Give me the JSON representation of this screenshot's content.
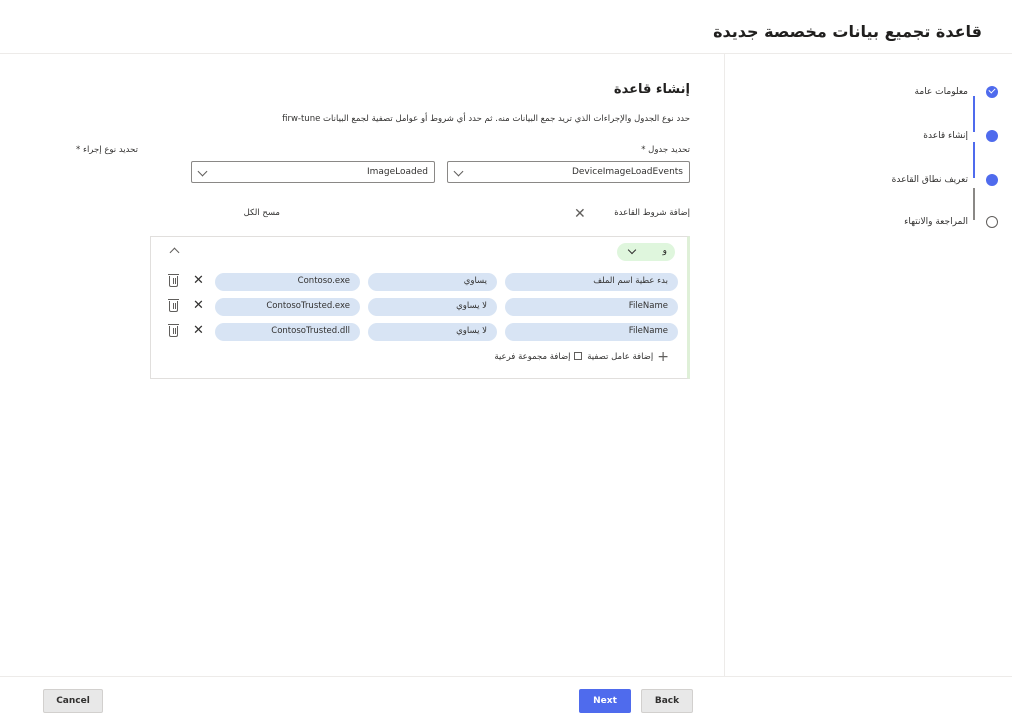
{
  "header": {
    "title": "قاعدة تجميع بيانات مخصصة جديدة"
  },
  "steps": [
    {
      "label": "معلومات عامة",
      "state": "completed"
    },
    {
      "label": "إنشاء قاعدة",
      "state": "current"
    },
    {
      "label": "تعريف نطاق القاعدة",
      "state": "current"
    },
    {
      "label": "المراجعة والانتهاء",
      "state": "pending"
    }
  ],
  "main": {
    "title": "إنشاء قاعدة",
    "description": "حدد نوع الجدول والإجراءات الذي تريد جمع البيانات منه. ثم حدد أي شروط أو عوامل تصفية لجمع البيانات firw-tune",
    "table_field": {
      "label": "تحديد جدول *",
      "value": "DeviceImageLoadEvents"
    },
    "action_field": {
      "label": "تحديد نوع إجراء *",
      "value": "ImageLoaded"
    },
    "add_conditions_label": "إضافة شروط القاعدة",
    "clear_all_label": "مسح الكل",
    "group_operator": "و",
    "conditions": [
      {
        "field": "بدء عطية اسم الملف",
        "operator": "يساوي",
        "value": "Contoso.exe"
      },
      {
        "field": "FileName",
        "operator": "لا يساوي",
        "value": "ContosoTrusted.exe"
      },
      {
        "field": "FileName",
        "operator": "لا يساوي",
        "value": "ContosoTrusted.dll"
      }
    ],
    "add_filter_label": "إضافة عامل تصفية",
    "add_subgroup_label": "إضافة مجموعة فرعية"
  },
  "footer": {
    "cancel_label": "Cancel",
    "next_label": "Next",
    "back_label": "Back"
  },
  "colors": {
    "accent": "#4f6bed",
    "pill": "#d8e4f4",
    "and_pill": "#dff6dd"
  }
}
